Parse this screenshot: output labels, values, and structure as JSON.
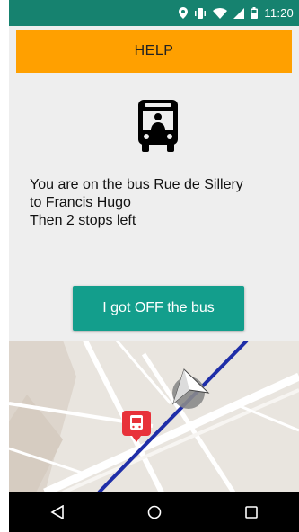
{
  "status_bar": {
    "time": "11:20",
    "icons": [
      "location-icon",
      "vibrate-icon",
      "wifi-icon",
      "signal-icon",
      "battery-icon"
    ],
    "color": "#16826f"
  },
  "help_button": {
    "label": "HELP",
    "color": "#ffa000"
  },
  "bus_icon": {
    "name": "bus-icon"
  },
  "message": {
    "line1": "You are on the bus Rue de Sillery",
    "line2": "to Francis Hugo",
    "line3": "Then 2 stops left"
  },
  "off_button": {
    "label": "I got OFF the bus",
    "color": "#139e8c"
  },
  "map": {
    "route_color": "#1f2ea8",
    "bus_stop_marker_color": "#e8323a",
    "icons": [
      "bus-stop-marker-icon",
      "navigation-arrow-icon"
    ]
  },
  "nav_bar": {
    "icons": [
      "back-icon",
      "home-icon",
      "recents-icon"
    ]
  }
}
